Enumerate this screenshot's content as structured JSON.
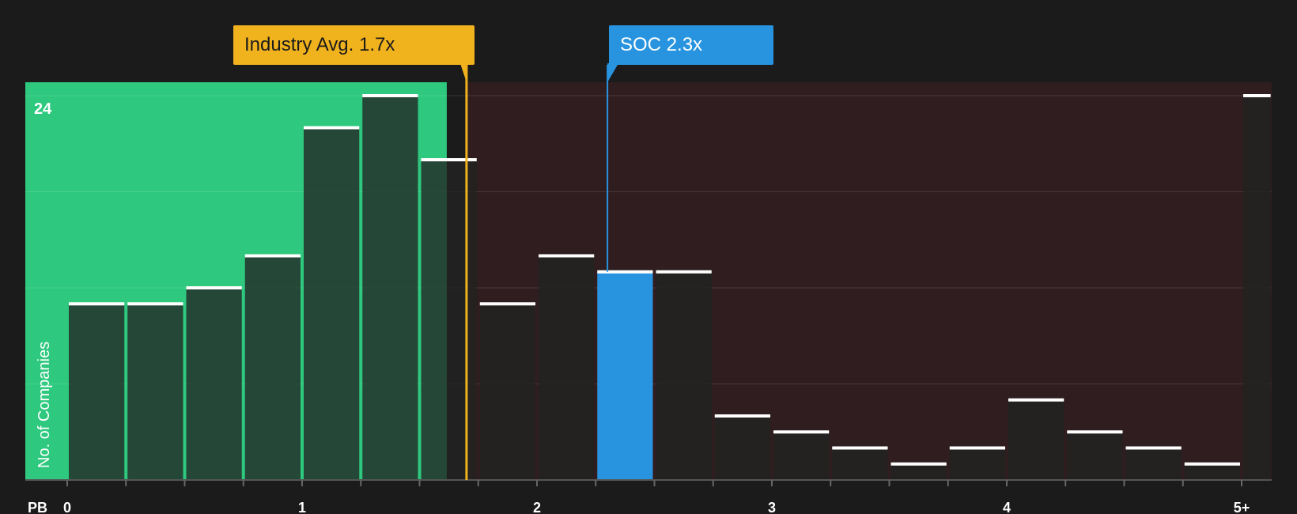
{
  "chart_data": {
    "type": "bar",
    "title": "",
    "xlabel": "PB",
    "ylabel": "No. of Companies",
    "x_tick_labels": [
      "0",
      "1",
      "2",
      "3",
      "4",
      "5+"
    ],
    "x_tick_values": [
      0,
      1,
      2,
      3,
      4,
      5
    ],
    "y_max_label": "24",
    "ylim": [
      0,
      24
    ],
    "xlim": [
      -0.18,
      5.13
    ],
    "bins": [
      {
        "start": 0.0,
        "end": 0.25,
        "count": 11
      },
      {
        "start": 0.25,
        "end": 0.5,
        "count": 11
      },
      {
        "start": 0.5,
        "end": 0.75,
        "count": 12
      },
      {
        "start": 0.75,
        "end": 1.0,
        "count": 14
      },
      {
        "start": 1.0,
        "end": 1.25,
        "count": 22
      },
      {
        "start": 1.25,
        "end": 1.5,
        "count": 24
      },
      {
        "start": 1.5,
        "end": 1.75,
        "count": 20
      },
      {
        "start": 1.75,
        "end": 2.0,
        "count": 11
      },
      {
        "start": 2.0,
        "end": 2.25,
        "count": 14
      },
      {
        "start": 2.25,
        "end": 2.5,
        "count": 13,
        "highlight": true
      },
      {
        "start": 2.5,
        "end": 2.75,
        "count": 13
      },
      {
        "start": 2.75,
        "end": 3.0,
        "count": 4
      },
      {
        "start": 3.0,
        "end": 3.25,
        "count": 3
      },
      {
        "start": 3.25,
        "end": 3.5,
        "count": 2
      },
      {
        "start": 3.5,
        "end": 3.75,
        "count": 1
      },
      {
        "start": 3.75,
        "end": 4.0,
        "count": 2
      },
      {
        "start": 4.0,
        "end": 4.25,
        "count": 5
      },
      {
        "start": 4.25,
        "end": 4.5,
        "count": 3
      },
      {
        "start": 4.5,
        "end": 4.75,
        "count": 2
      },
      {
        "start": 4.75,
        "end": 5.0,
        "count": 1
      },
      {
        "start": 5.0,
        "end": 5.13,
        "count": 24
      }
    ],
    "industry_avg": {
      "value": 1.7,
      "label": "Industry Avg. 1.7x"
    },
    "subject": {
      "value": 2.3,
      "label": "SOC 2.3x"
    },
    "colors": {
      "background": "#1b1b1b",
      "fair_zone": "#2ec97e",
      "over_zone": "#2f1d1f",
      "industry": "#f0b21d",
      "subject": "#2894e0",
      "bar_fill": "#222222",
      "bar_cap": "#ffffff"
    }
  }
}
